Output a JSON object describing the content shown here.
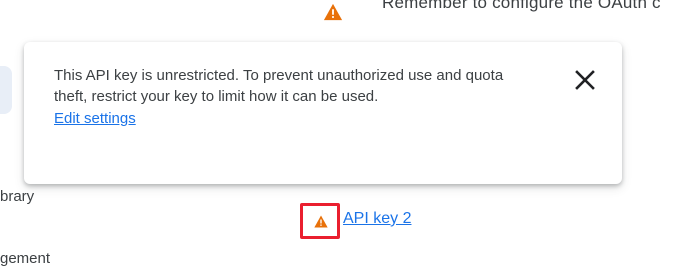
{
  "top_notice": {
    "text": "Remember to configure the OAuth c",
    "icon": "warning-icon"
  },
  "tooltip": {
    "message": "This API key is unrestricted. To prevent unauthorized use and quota theft, restrict your key to limit how it can be used.",
    "link_label": "Edit settings",
    "close_icon": "close-icon"
  },
  "side_nav": {
    "item_1": "brary",
    "item_2": "gement"
  },
  "api_key": {
    "warning_icon": "warning-icon",
    "label": "API key 2",
    "highlight_color": "#ea1f2f",
    "warning_color": "#e8710a"
  }
}
